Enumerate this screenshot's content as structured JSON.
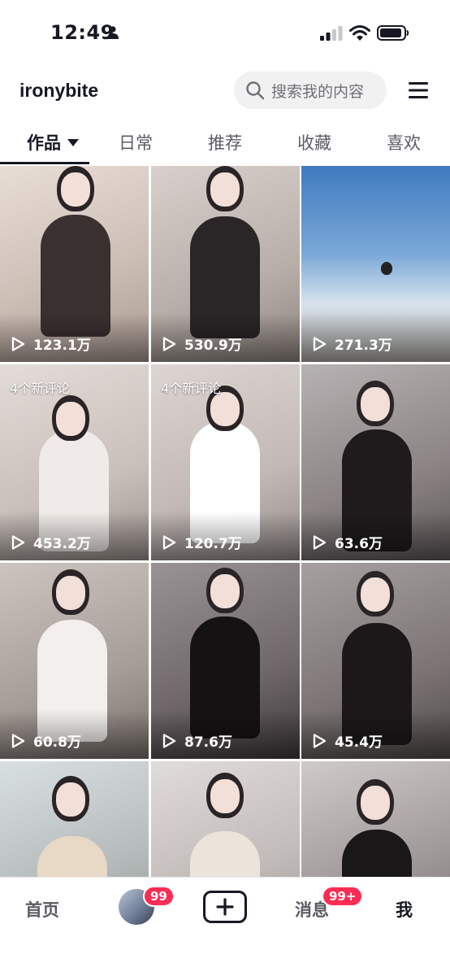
{
  "status_bar": {
    "time": "12:49",
    "icons": [
      "person-icon",
      "signal-icon",
      "wifi-icon",
      "battery-icon"
    ]
  },
  "header": {
    "username": "ironybite",
    "search_placeholder": "搜索我的内容",
    "icons": [
      "search-icon",
      "menu-icon"
    ]
  },
  "tabs": [
    {
      "label": "作品",
      "active": true
    },
    {
      "label": "日常",
      "active": false
    },
    {
      "label": "推荐",
      "active": false
    },
    {
      "label": "收藏",
      "active": false
    },
    {
      "label": "喜欢",
      "active": false
    }
  ],
  "videos": [
    {
      "plays": "123.1万",
      "badge": ""
    },
    {
      "plays": "530.9万",
      "badge": ""
    },
    {
      "plays": "271.3万",
      "badge": ""
    },
    {
      "plays": "453.2万",
      "badge": "4个新评论"
    },
    {
      "plays": "120.7万",
      "badge": "4个新评论"
    },
    {
      "plays": "63.6万",
      "badge": ""
    },
    {
      "plays": "60.8万",
      "badge": ""
    },
    {
      "plays": "87.6万",
      "badge": ""
    },
    {
      "plays": "45.4万",
      "badge": ""
    },
    {
      "plays": "",
      "badge": ""
    },
    {
      "plays": "",
      "badge": ""
    },
    {
      "plays": "",
      "badge": ""
    }
  ],
  "bottom_nav": {
    "home_label": "首页",
    "friends_badge": "99",
    "messages_label": "消息",
    "messages_badge": "99+",
    "me_label": "我"
  },
  "colors": {
    "accent": "#fe2c55",
    "text": "#161823",
    "secondary_text": "#5b5c63"
  }
}
